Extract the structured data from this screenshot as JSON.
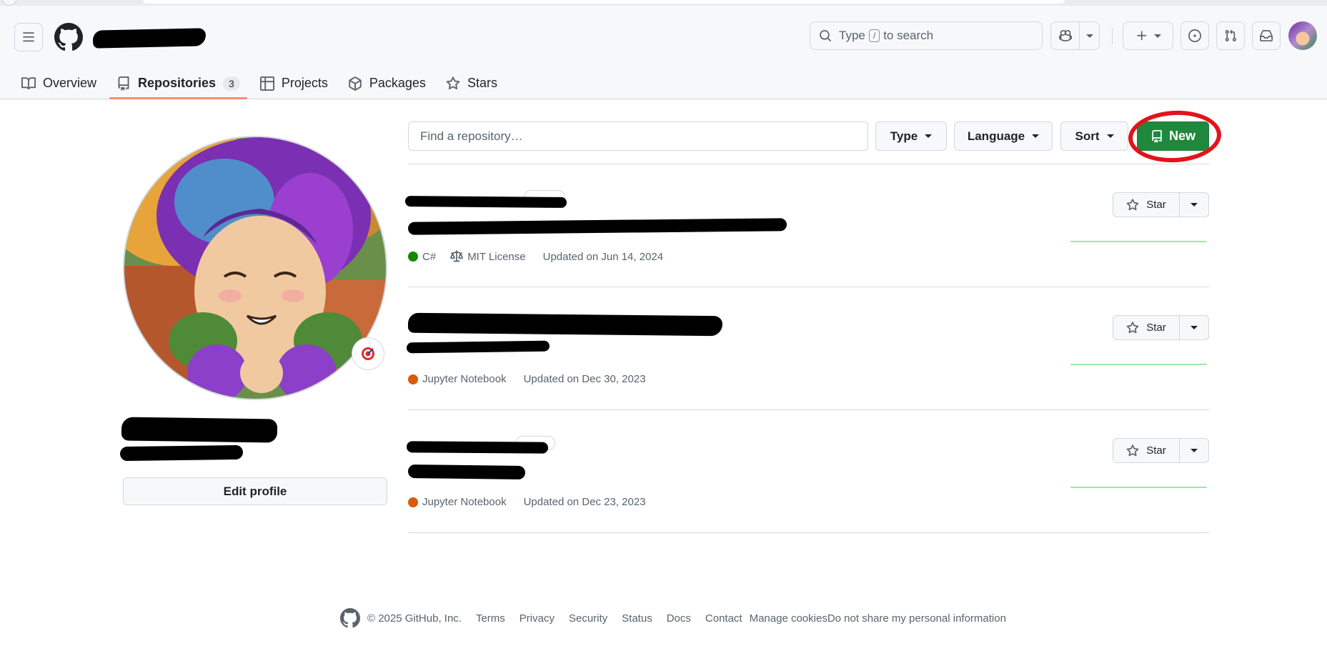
{
  "header": {
    "search": {
      "prefix": "Type",
      "key": "/",
      "suffix": "to search"
    }
  },
  "tabs": [
    {
      "label": "Overview",
      "icon": "book-icon"
    },
    {
      "label": "Repositories",
      "icon": "repo-icon",
      "count": "3",
      "selected": true
    },
    {
      "label": "Projects",
      "icon": "table-icon"
    },
    {
      "label": "Packages",
      "icon": "package-icon"
    },
    {
      "label": "Stars",
      "icon": "star-icon"
    }
  ],
  "profile": {
    "edit_label": "Edit profile",
    "status_emoji": "dart-icon"
  },
  "repo_toolbar": {
    "search_placeholder": "Find a repository…",
    "type_label": "Type",
    "language_label": "Language",
    "sort_label": "Sort",
    "new_label": "New"
  },
  "repos": [
    {
      "language": "C#",
      "language_color": "#178600",
      "license": "MIT License",
      "updated": "Updated on Jun 14, 2024",
      "star_label": "Star"
    },
    {
      "language": "Jupyter Notebook",
      "language_color": "#DA5B0B",
      "updated": "Updated on Dec 30, 2023",
      "star_label": "Star"
    },
    {
      "language": "Jupyter Notebook",
      "language_color": "#DA5B0B",
      "updated": "Updated on Dec 23, 2023",
      "star_label": "Star"
    }
  ],
  "footer": {
    "copyright": "© 2025 GitHub, Inc.",
    "links": [
      "Terms",
      "Privacy",
      "Security",
      "Status",
      "Docs",
      "Contact",
      "Manage cookies",
      "Do not share my personal information"
    ]
  },
  "colors": {
    "accent_green": "#1f883d",
    "link_blue": "#0969da",
    "tab_underline": "#fd8c73",
    "annotation_red": "#e3131b"
  }
}
